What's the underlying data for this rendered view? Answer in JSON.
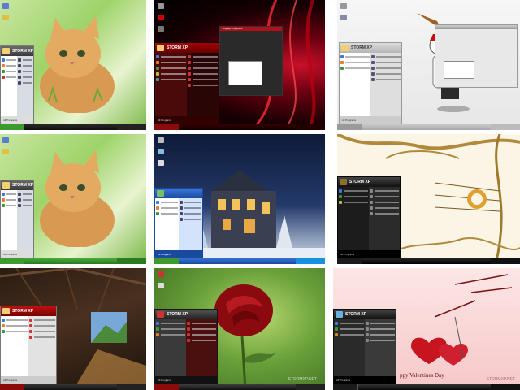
{
  "grid": {
    "tiles": [
      {
        "name": "tile-kitten-top",
        "brand": "STORM XP",
        "footer": "All Programs"
      },
      {
        "name": "tile-red-abstract",
        "brand": "STORM XP",
        "footer": "All Programs",
        "window_title": "Display Properties"
      },
      {
        "name": "tile-pirate-grey",
        "brand": "STORM XP",
        "footer": "All Programs"
      },
      {
        "name": "tile-kitten-mid",
        "brand": "STORM XP",
        "footer": "All Programs"
      },
      {
        "name": "tile-snow-house",
        "brand": "",
        "footer": "All Programs"
      },
      {
        "name": "tile-arabic-gold",
        "brand": "STORM XP",
        "footer": "All Programs"
      },
      {
        "name": "tile-attic-room",
        "brand": "STORM XP",
        "footer": "All Programs"
      },
      {
        "name": "tile-red-rose",
        "brand": "STORM XP",
        "footer": "All Programs",
        "watermark": "STORMXP.NET"
      },
      {
        "name": "tile-valentine",
        "brand": "STORM XP",
        "footer": "All Programs",
        "caption": "ppy Valentines Day",
        "watermark": "STORMXP.NET"
      }
    ]
  },
  "colors": {
    "xp_green": "#3c9a2e",
    "xp_blue": "#2a5fbf",
    "storm_red": "#8b0a0a",
    "storm_black": "#1a1a1a",
    "menu_white": "#f4f4f4"
  }
}
